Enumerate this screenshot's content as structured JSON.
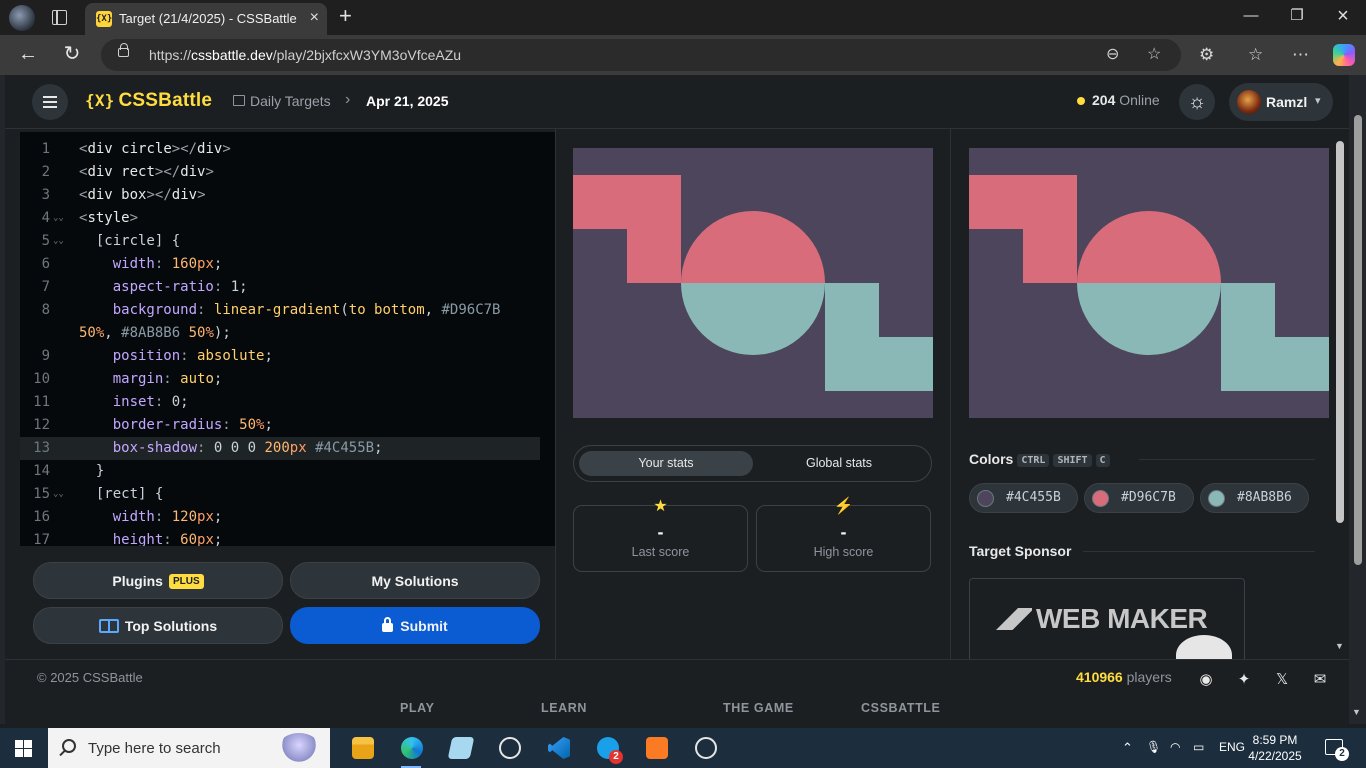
{
  "browser": {
    "tab_title": "Target (21/4/2025) - CSSBattle",
    "tab_favicon": "{X}",
    "url_prefix": "https://",
    "url_domain": "cssbattle.dev",
    "url_path": "/play/2bjxfcxW3YM3oVfceAZu"
  },
  "header": {
    "logo_mark": "{X}",
    "logo_text": "CSSBattle",
    "breadcrumb_root": "Daily Targets",
    "breadcrumb_current": "Apr 21, 2025",
    "online_count": "204",
    "online_label": "Online",
    "user_name": "Ramzl"
  },
  "editor": {
    "lines": [
      {
        "n": "1",
        "fold": "",
        "code": "<div circle></div>"
      },
      {
        "n": "2",
        "fold": "",
        "code": "<div rect></div>"
      },
      {
        "n": "3",
        "fold": "",
        "code": "<div box></div>"
      },
      {
        "n": "4",
        "fold": "⌄⌄",
        "code": "<style>"
      },
      {
        "n": "5",
        "fold": "⌄⌄",
        "code": "  [circle] {"
      },
      {
        "n": "6",
        "fold": "",
        "code": "    width: 160px;"
      },
      {
        "n": "7",
        "fold": "",
        "code": "    aspect-ratio: 1;"
      },
      {
        "n": "8",
        "fold": "",
        "code": "    background: linear-gradient(to bottom, #D96C7B"
      },
      {
        "n": "",
        "fold": "",
        "code": "50%, #8AB8B6 50%);"
      },
      {
        "n": "9",
        "fold": "",
        "code": "    position: absolute;"
      },
      {
        "n": "10",
        "fold": "",
        "code": "    margin: auto;"
      },
      {
        "n": "11",
        "fold": "",
        "code": "    inset: 0;"
      },
      {
        "n": "12",
        "fold": "",
        "code": "    border-radius: 50%;"
      },
      {
        "n": "13",
        "fold": "",
        "code": "    box-shadow: 0 0 0 200px #4C455B;"
      },
      {
        "n": "14",
        "fold": "",
        "code": "  }"
      },
      {
        "n": "15",
        "fold": "⌄⌄",
        "code": "  [rect] {"
      },
      {
        "n": "16",
        "fold": "",
        "code": "    width: 120px;"
      },
      {
        "n": "17",
        "fold": "",
        "code": "    height: 60px;"
      }
    ],
    "active_line": "13"
  },
  "buttons": {
    "plugins": "Plugins",
    "plugins_badge": "PLUS",
    "my_solutions": "My Solutions",
    "top_solutions": "Top Solutions",
    "submit": "Submit"
  },
  "stats": {
    "your_stats": "Your stats",
    "global_stats": "Global stats",
    "last_score_value": "-",
    "last_score_label": "Last score",
    "high_score_value": "-",
    "high_score_label": "High score"
  },
  "target": {
    "colors_title": "Colors",
    "shortcut_keys": [
      "CTRL",
      "SHIFT",
      "C"
    ],
    "colors": [
      {
        "hex": "#4C455B",
        "swatch": "#4c455b"
      },
      {
        "hex": "#D96C7B",
        "swatch": "#d96c7b"
      },
      {
        "hex": "#8AB8B6",
        "swatch": "#8ab8b6"
      }
    ],
    "sponsor_title": "Target Sponsor",
    "sponsor_name": "WEB MAKER",
    "palette": {
      "bg": "#4c455b",
      "pink": "#d96c7b",
      "teal": "#8ab8b6"
    }
  },
  "footer": {
    "copyright": "© 2025 CSSBattle",
    "players_count": "410966",
    "players_label": "players",
    "nav": [
      "PLAY",
      "LEARN",
      "THE GAME",
      "CSSBATTLE"
    ]
  },
  "taskbar": {
    "search_placeholder": "Type here to search",
    "language": "ENG",
    "time": "8:59 PM",
    "date": "4/22/2025",
    "notification_count": "2",
    "skype_badge": "2"
  },
  "icons": {
    "close": "×",
    "new_tab": "+",
    "minimize": "—",
    "maximize": "❐",
    "back": "←",
    "reload": "↻",
    "zoom": "⊖",
    "star": "☆",
    "extensions": "⚙",
    "favorites": "☆",
    "more": "⋯",
    "sun": "☼",
    "caret": "▾",
    "chevron": "›",
    "star_filled": "★",
    "bolt": "⚡",
    "discord": "◉",
    "bluesky": "✦",
    "x": "𝕏",
    "mail": "✉"
  }
}
